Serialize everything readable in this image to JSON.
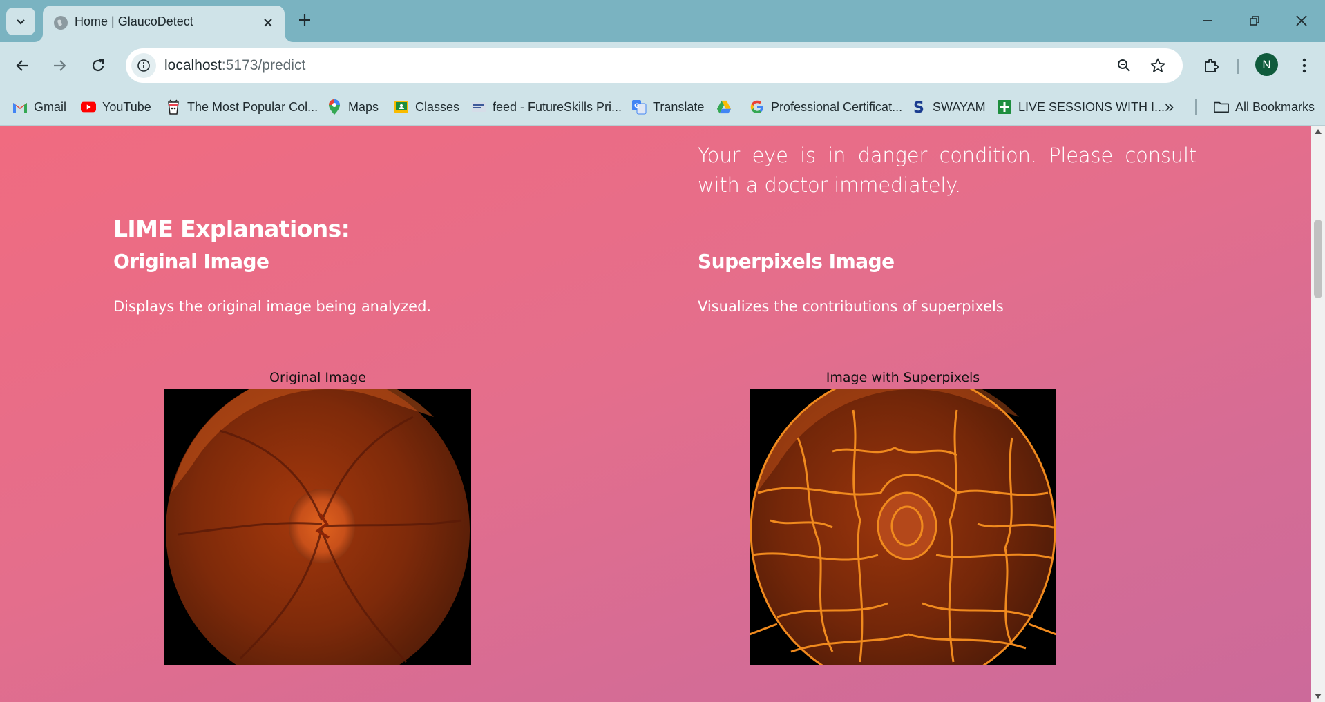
{
  "browser": {
    "tab_title": "Home | GlaucoDetect",
    "url_host": "localhost",
    "url_path": ":5173/predict",
    "profile_initial": "N",
    "accent_color": "#7ab3c1",
    "toolbar_color": "#cfe3e8"
  },
  "bookmarks": [
    {
      "label": "Gmail",
      "icon": "gmail-icon"
    },
    {
      "label": "YouTube",
      "icon": "youtube-icon"
    },
    {
      "label": "The Most Popular Col...",
      "icon": "cup-icon"
    },
    {
      "label": "Maps",
      "icon": "maps-pin-icon"
    },
    {
      "label": "Classes",
      "icon": "classroom-icon"
    },
    {
      "label": "feed - FutureSkills Pri...",
      "icon": "futureskills-icon"
    },
    {
      "label": "Translate",
      "icon": "translate-icon"
    },
    {
      "label": "",
      "icon": "drive-icon"
    },
    {
      "label": "Professional Certificat...",
      "icon": "google-icon"
    },
    {
      "label": "SWAYAM",
      "icon": "swayam-icon"
    },
    {
      "label": "LIVE SESSIONS WITH I...",
      "icon": "sheets-icon"
    }
  ],
  "bookmarks_overflow": "»",
  "all_bookmarks_label": "All Bookmarks",
  "page": {
    "result_message": "Your eye is in danger condition. Please consult with a doctor immediately.",
    "lime_heading": "LIME Explanations:",
    "original": {
      "heading": "Original Image",
      "description": "Displays the original image being analyzed.",
      "figure_caption": "Original Image"
    },
    "superpixels": {
      "heading": "Superpixels Image",
      "description": "Visualizes the contributions of superpixels",
      "figure_caption": "Image with Superpixels"
    }
  }
}
